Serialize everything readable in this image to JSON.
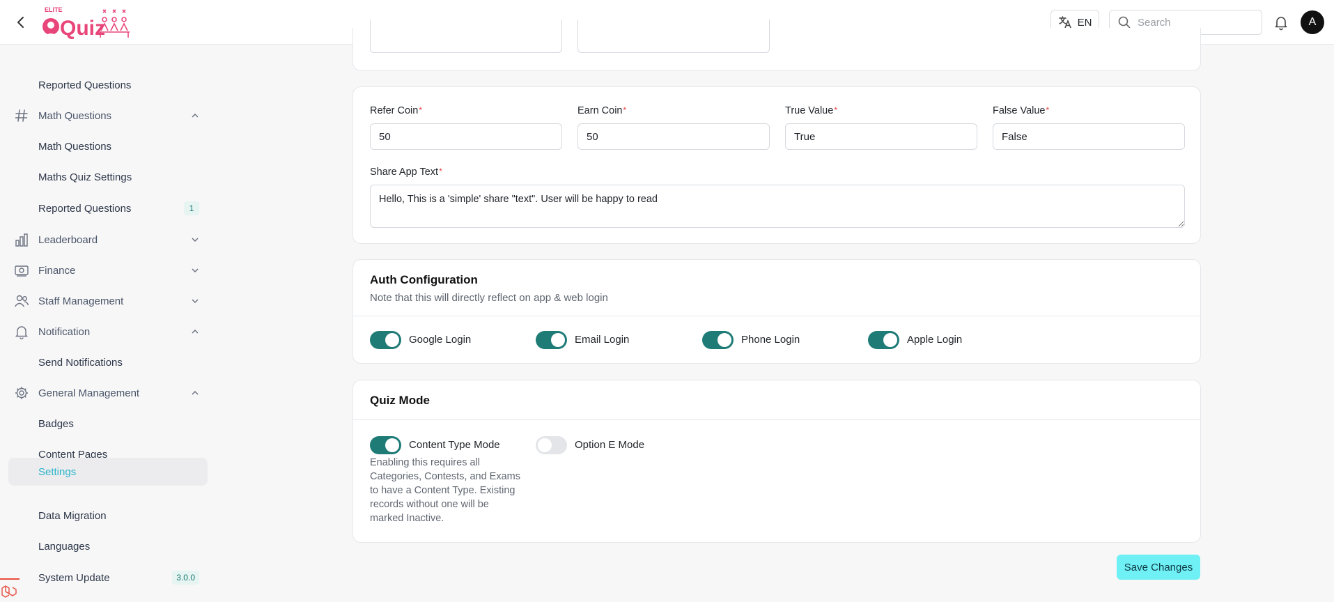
{
  "header": {
    "logo_small": "ELITE",
    "logo_main": "Quiz",
    "language": "EN",
    "search_placeholder": "Search",
    "avatar_initial": "A"
  },
  "sidebar": {
    "items": [
      {
        "label": "Reported Questions",
        "kind": "sub"
      },
      {
        "label": "Math Questions",
        "kind": "parent",
        "icon": "hash-icon",
        "expanded": true
      },
      {
        "label": "Math Questions",
        "kind": "sub"
      },
      {
        "label": "Maths Quiz Settings",
        "kind": "sub"
      },
      {
        "label": "Reported Questions",
        "kind": "sub",
        "badge": "1"
      },
      {
        "label": "Leaderboard",
        "kind": "parent",
        "icon": "chart-bar-icon",
        "expanded": false
      },
      {
        "label": "Finance",
        "kind": "parent",
        "icon": "money-icon",
        "expanded": false
      },
      {
        "label": "Staff Management",
        "kind": "parent",
        "icon": "users-icon",
        "expanded": false
      },
      {
        "label": "Notification",
        "kind": "parent",
        "icon": "bell-icon",
        "expanded": true
      },
      {
        "label": "Send Notifications",
        "kind": "sub"
      },
      {
        "label": "General Management",
        "kind": "parent",
        "icon": "gear-icon",
        "expanded": true
      },
      {
        "label": "Badges",
        "kind": "sub"
      },
      {
        "label": "Content Pages",
        "kind": "sub"
      },
      {
        "label": "Settings",
        "kind": "sub",
        "active": true
      },
      {
        "label": "Data Migration",
        "kind": "sub"
      },
      {
        "label": "Languages",
        "kind": "sub"
      },
      {
        "label": "System Update",
        "kind": "sub",
        "badge": "3.0.0"
      }
    ]
  },
  "coins": {
    "refer_coin": {
      "label": "Refer Coin",
      "value": "50"
    },
    "earn_coin": {
      "label": "Earn Coin",
      "value": "50"
    },
    "true_value": {
      "label": "True Value",
      "value": "True"
    },
    "false_value": {
      "label": "False Value",
      "value": "False"
    },
    "share_text": {
      "label": "Share App Text",
      "value": "Hello, This is a 'simple' share \"text\". User will be happy to read"
    },
    "required_mark": "*"
  },
  "auth": {
    "title": "Auth Configuration",
    "subtitle": "Note that this will directly reflect on app & web login",
    "toggles": [
      {
        "label": "Google Login",
        "on": true
      },
      {
        "label": "Email Login",
        "on": true
      },
      {
        "label": "Phone Login",
        "on": true
      },
      {
        "label": "Apple Login",
        "on": true
      }
    ]
  },
  "quiz_mode": {
    "title": "Quiz Mode",
    "content_type": {
      "label": "Content Type Mode",
      "on": true
    },
    "option_e": {
      "label": "Option E Mode",
      "on": false
    },
    "hint": "Enabling this requires all Categories, Contests, and Exams to have a Content Type. Existing records without one will be marked Inactive."
  },
  "actions": {
    "save_label": "Save Changes"
  },
  "colors": {
    "accent": "#1e7b76",
    "active_nav": "#2bb5c8",
    "save_button": "#6ff0f5",
    "logo_pink": "#e8457a"
  }
}
